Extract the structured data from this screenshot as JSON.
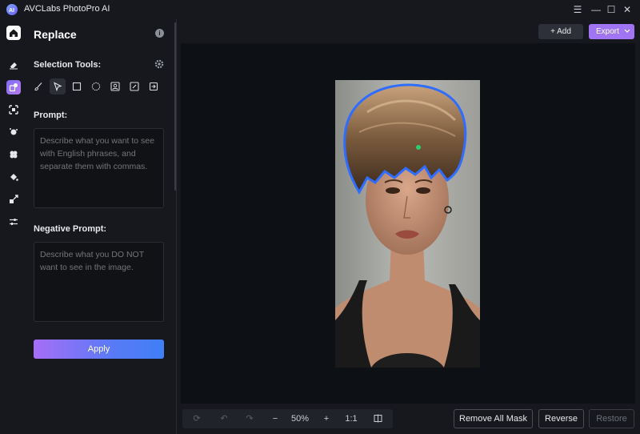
{
  "app": {
    "title": "AVCLabs PhotoPro AI"
  },
  "window_controls": [
    "☰",
    "—",
    "☐",
    "✕"
  ],
  "rail": {
    "items": [
      "home-icon",
      "eraser-icon",
      "replace-icon",
      "upscale-icon",
      "background-icon",
      "colorize-icon",
      "fill-icon",
      "resize-icon",
      "adjust-icon"
    ],
    "active": "replace-icon"
  },
  "panel": {
    "title": "Replace",
    "selection_tools_label": "Selection Tools:",
    "tools": [
      "brush-icon",
      "pointer-icon",
      "rectangle-icon",
      "ellipse-icon",
      "portrait-icon",
      "auto-select-icon",
      "import-icon"
    ],
    "selected_tool": "pointer-icon",
    "prompt_label": "Prompt:",
    "prompt_placeholder": "Describe what you want to see with English phrases, and separate them with commas.",
    "negative_label": "Negative Prompt:",
    "negative_placeholder": "Describe what you DO NOT want to see in the image.",
    "apply_label": "Apply"
  },
  "topbar": {
    "add_label": "+ Add",
    "export_label": "Export"
  },
  "bottom": {
    "zoom": "50%",
    "one_to_one": "1:1",
    "remove_all_mask": "Remove All Mask",
    "reverse": "Reverse",
    "restore": "Restore"
  },
  "colors": {
    "accent": "#a074f3",
    "mask_outline": "#2f6dff",
    "point": "#2ecc71"
  }
}
